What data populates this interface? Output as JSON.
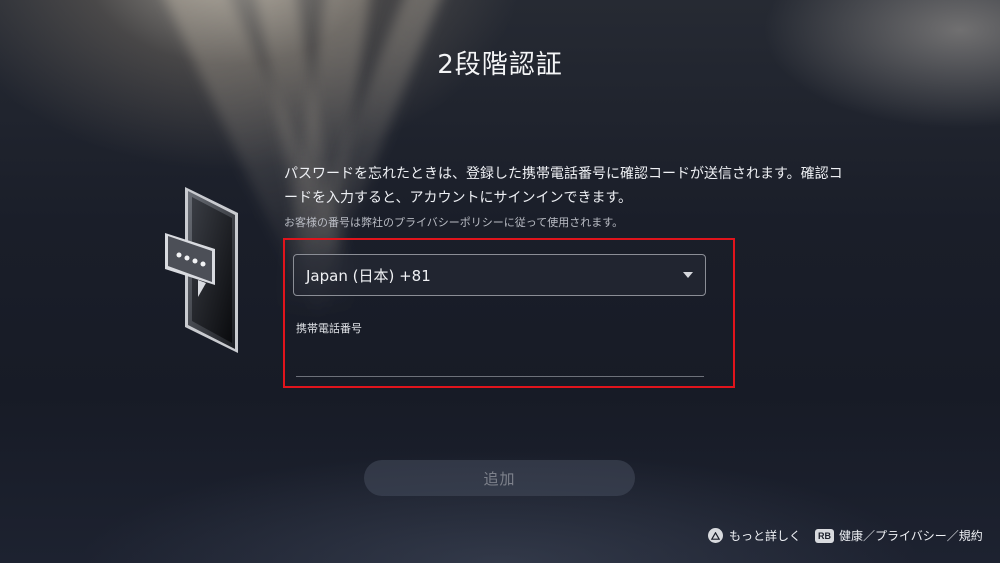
{
  "page": {
    "title": "2段階認証",
    "description": "パスワードを忘れたときは、登録した携帯電話番号に確認コードが送信されます。確認コードを入力すると、アカウントにサインインできます。",
    "privacy_note": "お客様の番号は弊社のプライバシーポリシーに従って使用されます。"
  },
  "form": {
    "country_select": {
      "value": "Japan (日本) +81",
      "icon": "chevron-down-icon"
    },
    "phone_field": {
      "label": "携帯電話番号",
      "value": ""
    },
    "add_button": {
      "label": "追加",
      "state": "disabled"
    }
  },
  "footer": {
    "more_info": {
      "icon": "triangle-button-icon",
      "label": "もっと詳しく"
    },
    "legal": {
      "badge": "RB",
      "label": "健康／プライバシー／規約"
    }
  },
  "colors": {
    "highlight": "#e0141c",
    "background": "#171b26"
  }
}
